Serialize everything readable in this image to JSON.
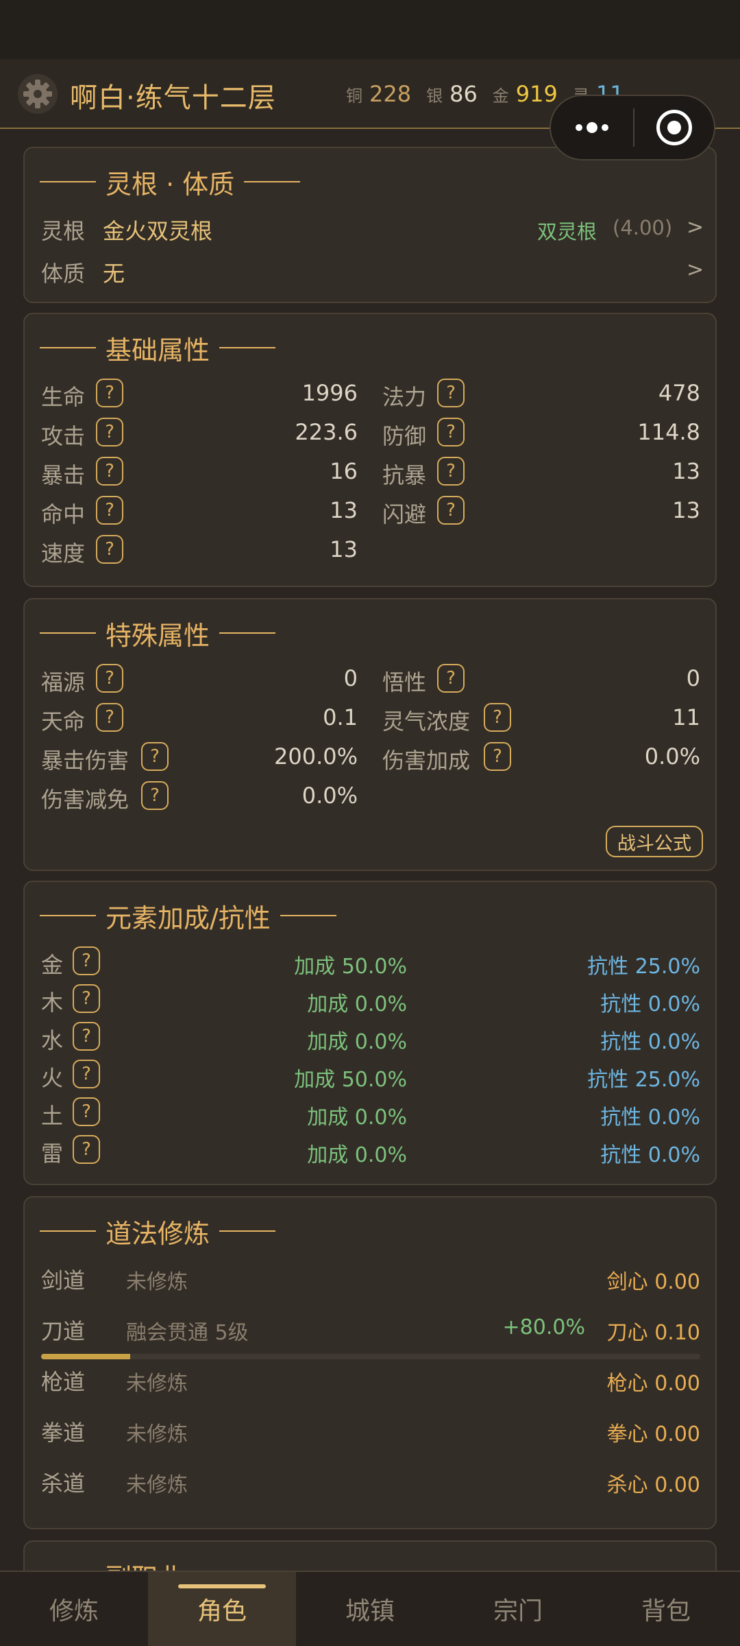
{
  "header": {
    "title": "啊白·练气十二层",
    "currency": [
      {
        "label": "铜",
        "value": "228"
      },
      {
        "label": "银",
        "value": "86"
      },
      {
        "label": "金",
        "value": "919"
      },
      {
        "label": "灵",
        "value": "11"
      }
    ],
    "icons": {
      "settings": "gear-icon",
      "more": "more-dots-icon",
      "close": "target-close-icon"
    }
  },
  "root_card": {
    "title": "灵根 · 体质",
    "rows": [
      {
        "label": "灵根",
        "value": "金火双灵根",
        "tag": "双灵根",
        "score": "(4.00)",
        "arrow": ">"
      },
      {
        "label": "体质",
        "value": "无",
        "arrow": ">"
      }
    ]
  },
  "base_card": {
    "title": "基础属性",
    "q": "?",
    "rows": [
      {
        "left_label": "生命",
        "left_value": "1996",
        "right_label": "法力",
        "right_value": "478"
      },
      {
        "left_label": "攻击",
        "left_value": "223.6",
        "right_label": "防御",
        "right_value": "114.8"
      },
      {
        "left_label": "暴击",
        "left_value": "16",
        "right_label": "抗暴",
        "right_value": "13"
      },
      {
        "left_label": "命中",
        "left_value": "13",
        "right_label": "闪避",
        "right_value": "13"
      },
      {
        "left_label": "速度",
        "left_value": "13"
      }
    ]
  },
  "special_card": {
    "title": "特殊属性",
    "q": "?",
    "rows": [
      {
        "left_label": "福源",
        "left_value": "0",
        "right_label": "悟性",
        "right_value": "0"
      },
      {
        "left_label": "天命",
        "left_value": "0.1",
        "right_label": "灵气浓度",
        "right_value": "11"
      },
      {
        "left_label": "暴击伤害",
        "left_value": "200.0%",
        "right_label": "伤害加成",
        "right_value": "0.0%"
      },
      {
        "left_label": "伤害减免",
        "left_value": "0.0%"
      }
    ],
    "formula_button": "战斗公式"
  },
  "element_card": {
    "title": "元素加成/抗性",
    "q": "?",
    "rows": [
      {
        "label": "金",
        "bonus": "加成 50.0%",
        "resist": "抗性 25.0%"
      },
      {
        "label": "木",
        "bonus": "加成 0.0%",
        "resist": "抗性 0.0%"
      },
      {
        "label": "水",
        "bonus": "加成 0.0%",
        "resist": "抗性 0.0%"
      },
      {
        "label": "火",
        "bonus": "加成 50.0%",
        "resist": "抗性 25.0%"
      },
      {
        "label": "土",
        "bonus": "加成 0.0%",
        "resist": "抗性 0.0%"
      },
      {
        "label": "雷",
        "bonus": "加成 0.0%",
        "resist": "抗性 0.0%"
      }
    ]
  },
  "dao_card": {
    "title": "道法修炼",
    "rows": [
      {
        "label": "剑道",
        "status": "未修炼",
        "bonus": "",
        "heart": "剑心 0.00"
      },
      {
        "label": "刀道",
        "status": "融会贯通 5级",
        "bonus": "+80.0%",
        "heart": "刀心 0.10",
        "progress": 0.135
      },
      {
        "label": "枪道",
        "status": "未修炼",
        "bonus": "",
        "heart": "枪心 0.00"
      },
      {
        "label": "拳道",
        "status": "未修炼",
        "bonus": "",
        "heart": "拳心 0.00"
      },
      {
        "label": "杀道",
        "status": "未修炼",
        "bonus": "",
        "heart": "杀心 0.00"
      }
    ]
  },
  "next_card": {
    "title": "副职业"
  },
  "tabs": [
    {
      "label": "修炼",
      "active": false
    },
    {
      "label": "角色",
      "active": true
    },
    {
      "label": "城镇",
      "active": false
    },
    {
      "label": "宗门",
      "active": false
    },
    {
      "label": "背包",
      "active": false
    }
  ],
  "colors": {
    "accent": "#e6b464",
    "bonus": "#7cc27c",
    "resist": "#6cb6e2",
    "heart": "#e8ad52"
  }
}
